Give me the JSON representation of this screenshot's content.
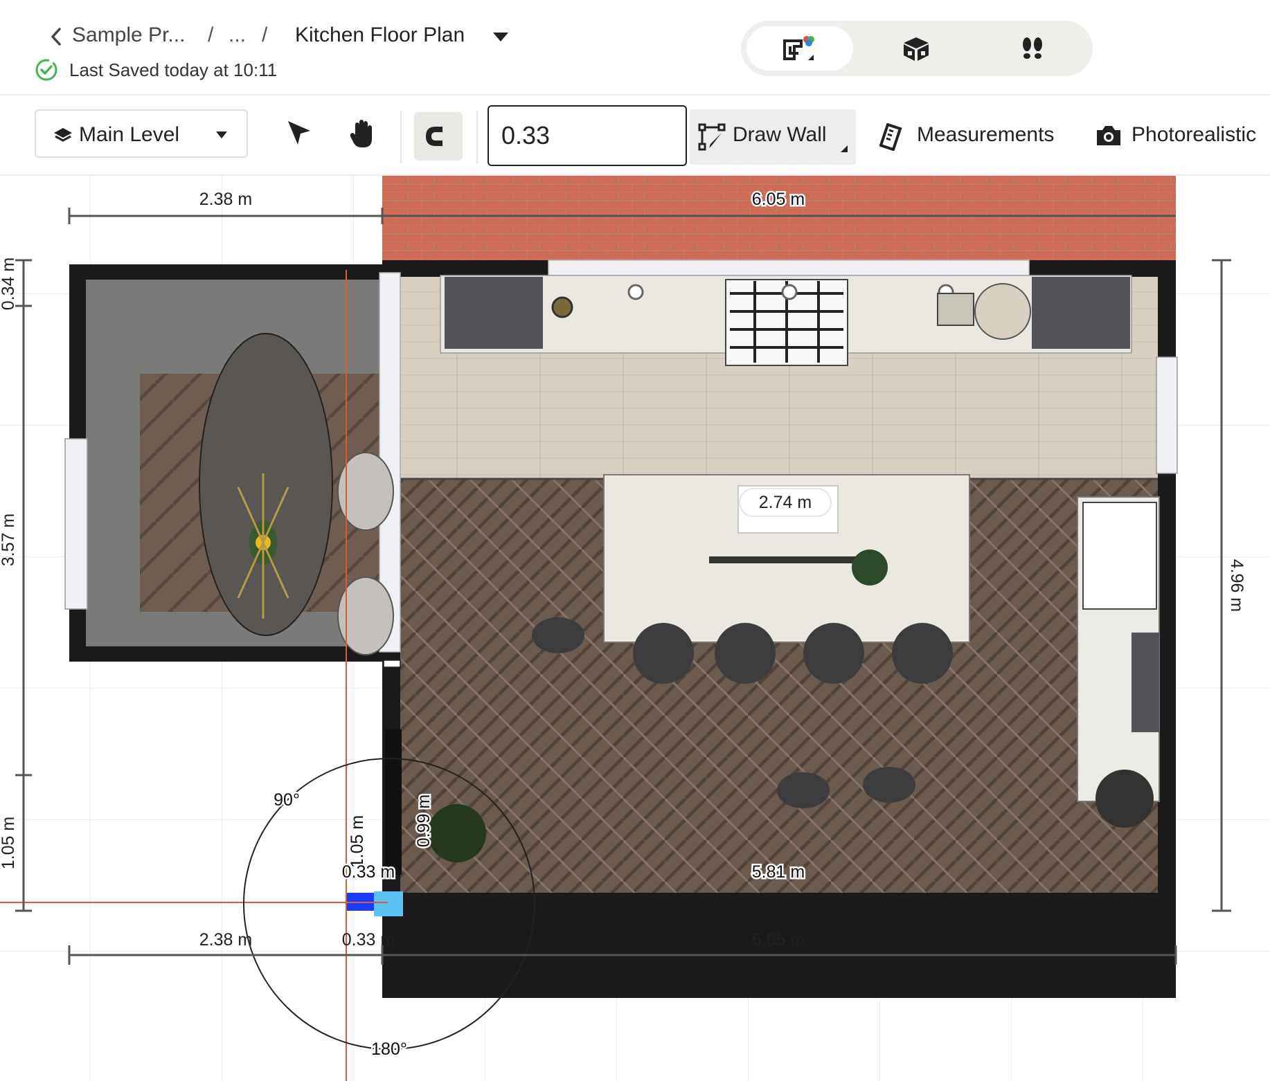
{
  "breadcrumb": {
    "project": "Sample Pr...",
    "separator": "/",
    "ellipsis": "...",
    "current": "Kitchen Floor Plan"
  },
  "save_status": "Last Saved today at 10:11",
  "view_modes": [
    {
      "name": "2d-plan-icon",
      "active": true
    },
    {
      "name": "3d-view-icon",
      "active": false
    },
    {
      "name": "walkthrough-icon",
      "active": false
    }
  ],
  "toolbar": {
    "level": "Main Level",
    "length_value": "0.33",
    "draw_wall": "Draw Wall",
    "measurements": "Measurements",
    "photorealistic": "Photorealistic"
  },
  "dimensions": {
    "top_left": "2.38 m",
    "top_right": "6.05 m",
    "left_1": "0.34 m",
    "left_2": "3.57 m",
    "left_3": "1.05 m",
    "right": "4.96 m",
    "island": "2.74 m",
    "inner_bottom": "5.81 m",
    "stub_height": "1.05 m",
    "stub_right": "0.99 m",
    "stub_width_top": "0.33 m",
    "stub_width_bottom": "0.33 m",
    "bottom_left": "2.38 m",
    "bottom_right": "6.05 m",
    "angle_90": "90°",
    "angle_180": "180°"
  },
  "colors": {
    "accent_green": "#3fb94a",
    "guide_orange": "#e05a2b",
    "wall_draw_blue": "#1a3cff"
  }
}
